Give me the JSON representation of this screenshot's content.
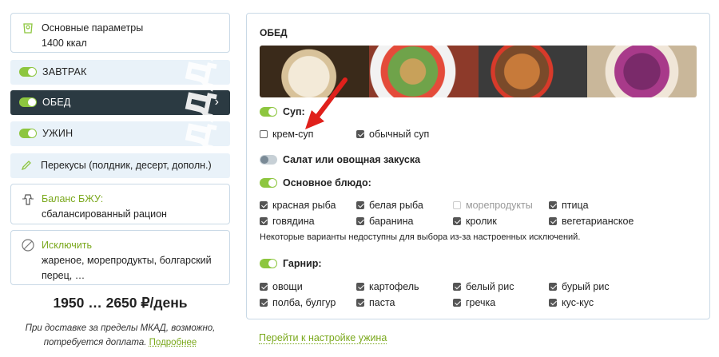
{
  "sidebar": {
    "params": {
      "title": "Основные параметры",
      "value": "1400 ккал"
    },
    "meals": [
      {
        "label": "ЗАВТРАК",
        "active": false
      },
      {
        "label": "ОБЕД",
        "active": true
      },
      {
        "label": "УЖИН",
        "active": false
      }
    ],
    "snacks_label": "Перекусы (полдник, десерт, дополн.)",
    "balance": {
      "title": "Баланс БЖУ:",
      "value": "сбалансированный рацион"
    },
    "exclude": {
      "title": "Исключить",
      "value": "жареное, морепродукты, болгарский перец, …"
    },
    "price": "1950 … 2650 ₽/день",
    "delivery_note": "При доставке за пределы МКАД, возможно, потребуется доплата.",
    "more_link": "Подробнее",
    "watermark": "ЕДА"
  },
  "panel": {
    "title": "ОБЕД",
    "soup": {
      "label": "Суп:",
      "enabled": true,
      "options": [
        {
          "label": "крем-суп",
          "checked": false
        },
        {
          "label": "обычный суп",
          "checked": true
        }
      ]
    },
    "salad": {
      "label": "Салат или овощная закуска",
      "enabled": false
    },
    "main": {
      "label": "Основное блюдо:",
      "enabled": true,
      "options": [
        {
          "label": "красная рыба",
          "checked": true
        },
        {
          "label": "белая рыба",
          "checked": true
        },
        {
          "label": "морепродукты",
          "checked": false,
          "disabled": true
        },
        {
          "label": "птица",
          "checked": true
        },
        {
          "label": "говядина",
          "checked": true
        },
        {
          "label": "баранина",
          "checked": true
        },
        {
          "label": "кролик",
          "checked": true
        },
        {
          "label": "вегетарианское",
          "checked": true
        }
      ],
      "warning": "Некоторые варианты недоступны для выбора из-за настроенных исключений."
    },
    "garnish": {
      "label": "Гарнир:",
      "enabled": true,
      "options": [
        {
          "label": "овощи",
          "checked": true
        },
        {
          "label": "картофель",
          "checked": true
        },
        {
          "label": "белый рис",
          "checked": true
        },
        {
          "label": "бурый рис",
          "checked": true
        },
        {
          "label": "полба, булгур",
          "checked": true
        },
        {
          "label": "паста",
          "checked": true
        },
        {
          "label": "гречка",
          "checked": true
        },
        {
          "label": "кус-кус",
          "checked": true
        }
      ]
    }
  },
  "next_link": "Перейти к настройке ужина",
  "colors": {
    "accent": "#7aa81c",
    "toggle_on": "#8dc63f",
    "active_row": "#2b3a42",
    "row_bg": "#e9f2f9",
    "arrow": "#e0201b"
  },
  "icons": {
    "params": "scale-icon",
    "snacks": "pencil-icon",
    "balance": "mannequin-icon",
    "exclude": "no-symbol-icon",
    "chevron": "chevron-right-icon"
  }
}
